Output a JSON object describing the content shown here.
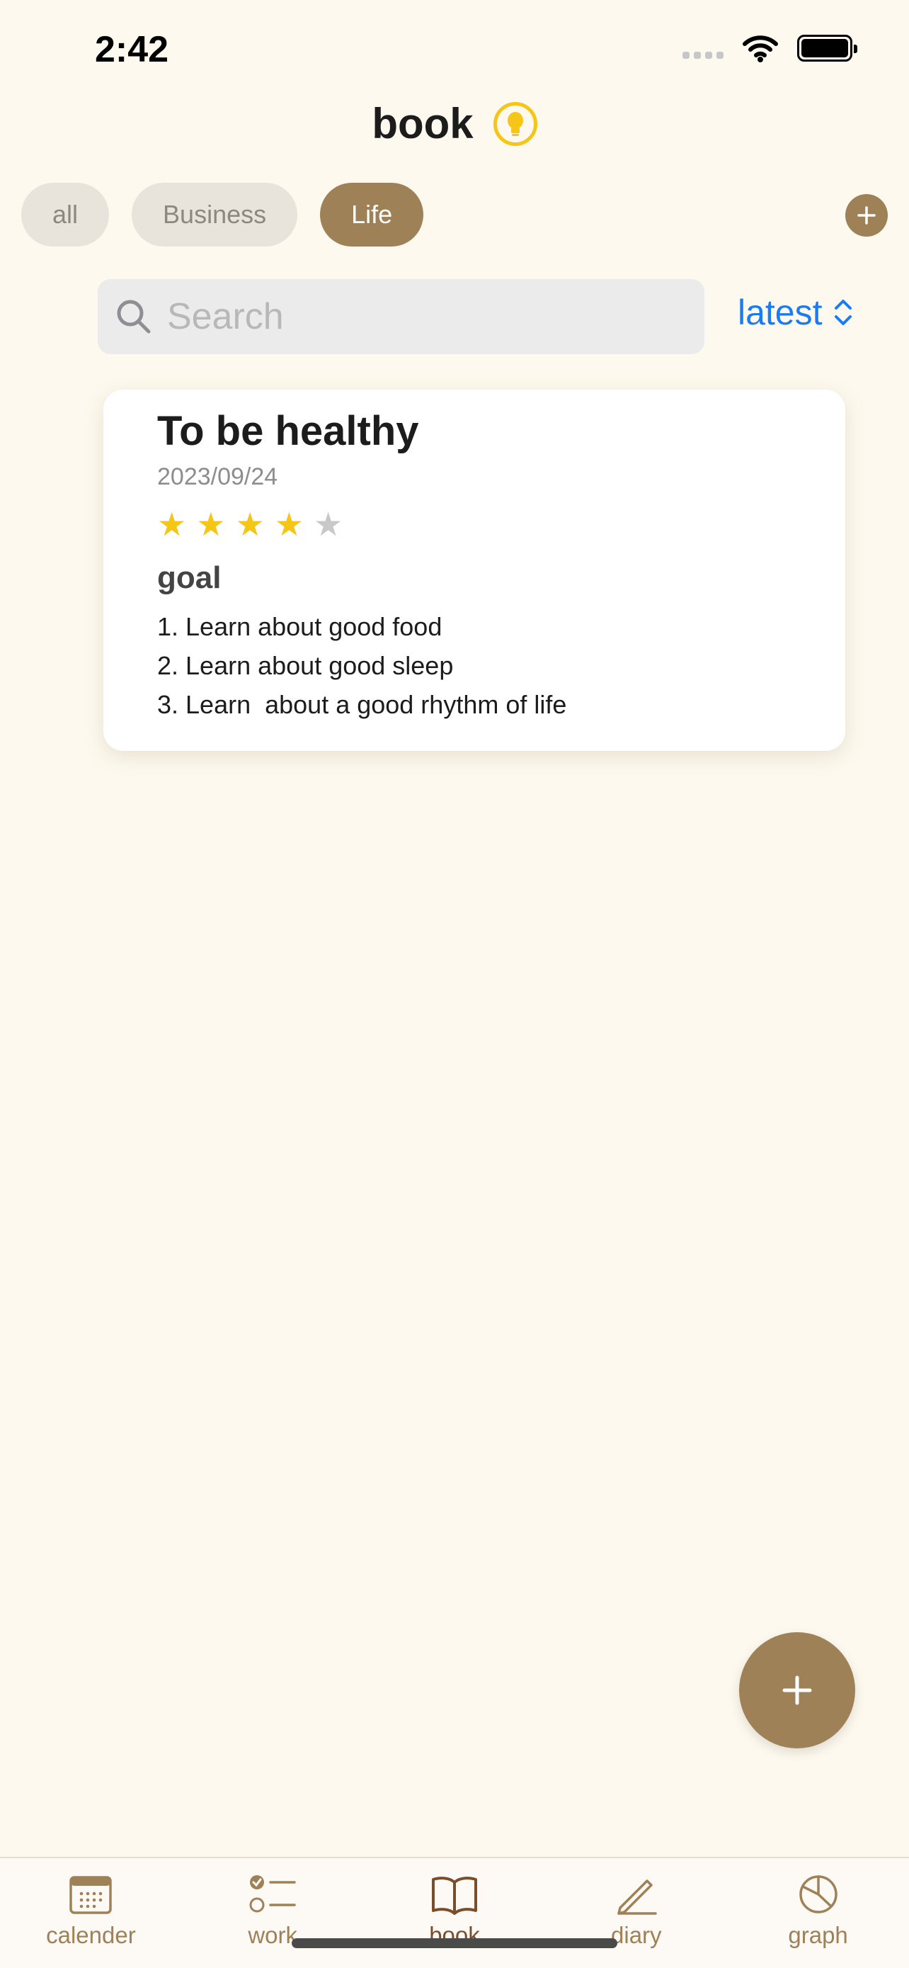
{
  "status_bar": {
    "time": "2:42",
    "icons": [
      "signal-icon",
      "wifi-icon",
      "battery-icon"
    ]
  },
  "header": {
    "title": "book",
    "icon": "lightbulb-icon"
  },
  "categories": {
    "items": [
      {
        "label": "all",
        "active": false
      },
      {
        "label": "Business",
        "active": false
      },
      {
        "label": "Life",
        "active": true
      }
    ],
    "add_icon": "plus-icon"
  },
  "search": {
    "placeholder": "Search",
    "value": "",
    "sort_label": "latest"
  },
  "cards": [
    {
      "title": "To be healthy",
      "date": "2023/09/24",
      "rating": 4,
      "rating_max": 5,
      "section": "goal",
      "items": [
        "1. Learn about good food",
        "2. Learn about good sleep",
        "3. Learn  about a good rhythm of life"
      ]
    }
  ],
  "fab_icon": "plus-icon",
  "tabs": [
    {
      "label": "calender",
      "icon": "calendar-icon",
      "active": false
    },
    {
      "label": "work",
      "icon": "checklist-icon",
      "active": false
    },
    {
      "label": "book",
      "icon": "book-icon",
      "active": true
    },
    {
      "label": "diary",
      "icon": "pencil-icon",
      "active": false
    },
    {
      "label": "graph",
      "icon": "pie-chart-icon",
      "active": false
    }
  ],
  "colors": {
    "background": "#fdf9ee",
    "accent": "#9f8158",
    "active_tab": "#7a4e2a",
    "link": "#1a7cf5",
    "star_on": "#f5c518",
    "star_off": "#c8c8c8"
  }
}
